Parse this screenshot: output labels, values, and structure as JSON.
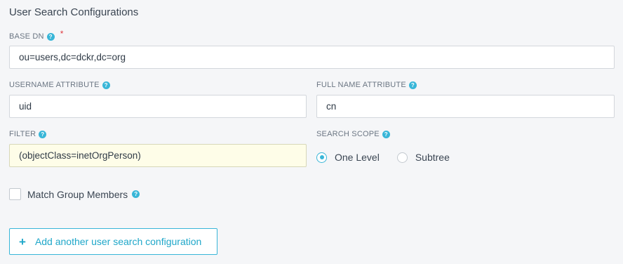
{
  "section": {
    "title": "User Search Configurations"
  },
  "fields": {
    "base_dn": {
      "label": "BASE DN",
      "required_marker": "*",
      "value": "ou=users,dc=dckr,dc=org"
    },
    "username_attribute": {
      "label": "USERNAME ATTRIBUTE",
      "value": "uid"
    },
    "full_name_attribute": {
      "label": "FULL NAME ATTRIBUTE",
      "value": "cn"
    },
    "filter": {
      "label": "FILTER",
      "value": "(objectClass=inetOrgPerson)"
    },
    "search_scope": {
      "label": "SEARCH SCOPE",
      "options": [
        {
          "label": "One Level",
          "selected": true
        },
        {
          "label": "Subtree",
          "selected": false
        }
      ]
    }
  },
  "match_group_members": {
    "label": "Match Group Members",
    "checked": false
  },
  "add_button": {
    "icon": "+",
    "label": "Add another user search configuration"
  },
  "icons": {
    "help": "?"
  },
  "colors": {
    "accent": "#38b6d8",
    "required": "#e0383e",
    "background": "#f5f6f8",
    "filter_highlight": "#fefde8"
  }
}
